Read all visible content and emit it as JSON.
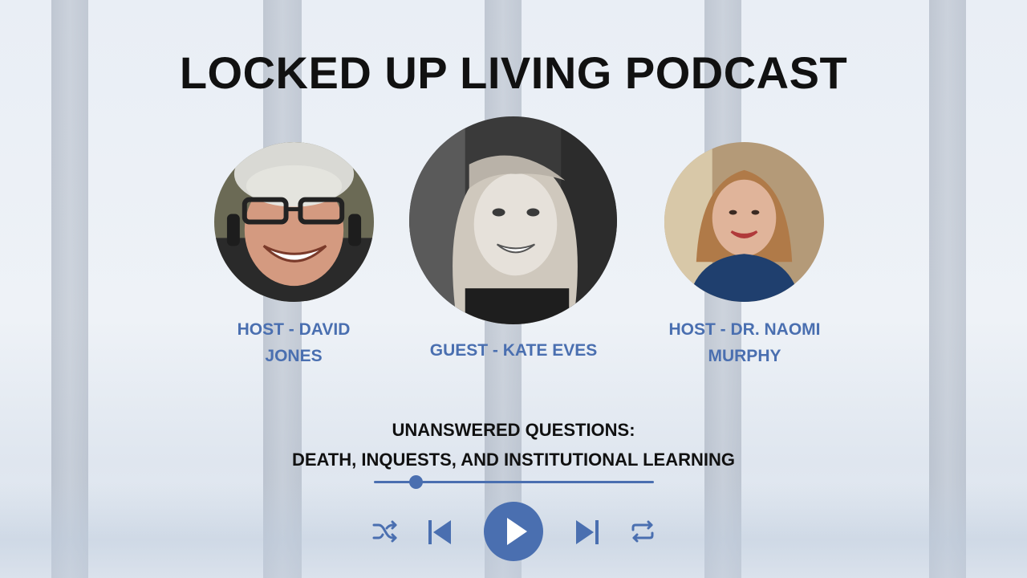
{
  "title": "LOCKED UP LIVING PODCAST",
  "people": [
    {
      "role_line1": "HOST - DAVID",
      "role_line2": "JONES"
    },
    {
      "role_line1": "GUEST - KATE EVES"
    },
    {
      "role_line1": "HOST - DR. NAOMI",
      "role_line2": "MURPHY"
    }
  ],
  "episode": {
    "line1": "UNANSWERED QUESTIONS:",
    "line2": "DEATH, INQUESTS, AND INSTITUTIONAL LEARNING"
  },
  "player": {
    "progress": 0.15,
    "controls": [
      "shuffle-icon",
      "skip-previous-icon",
      "play-icon",
      "skip-next-icon",
      "repeat-icon"
    ]
  },
  "colors": {
    "accent": "#4a6fb0",
    "title": "#111111"
  }
}
